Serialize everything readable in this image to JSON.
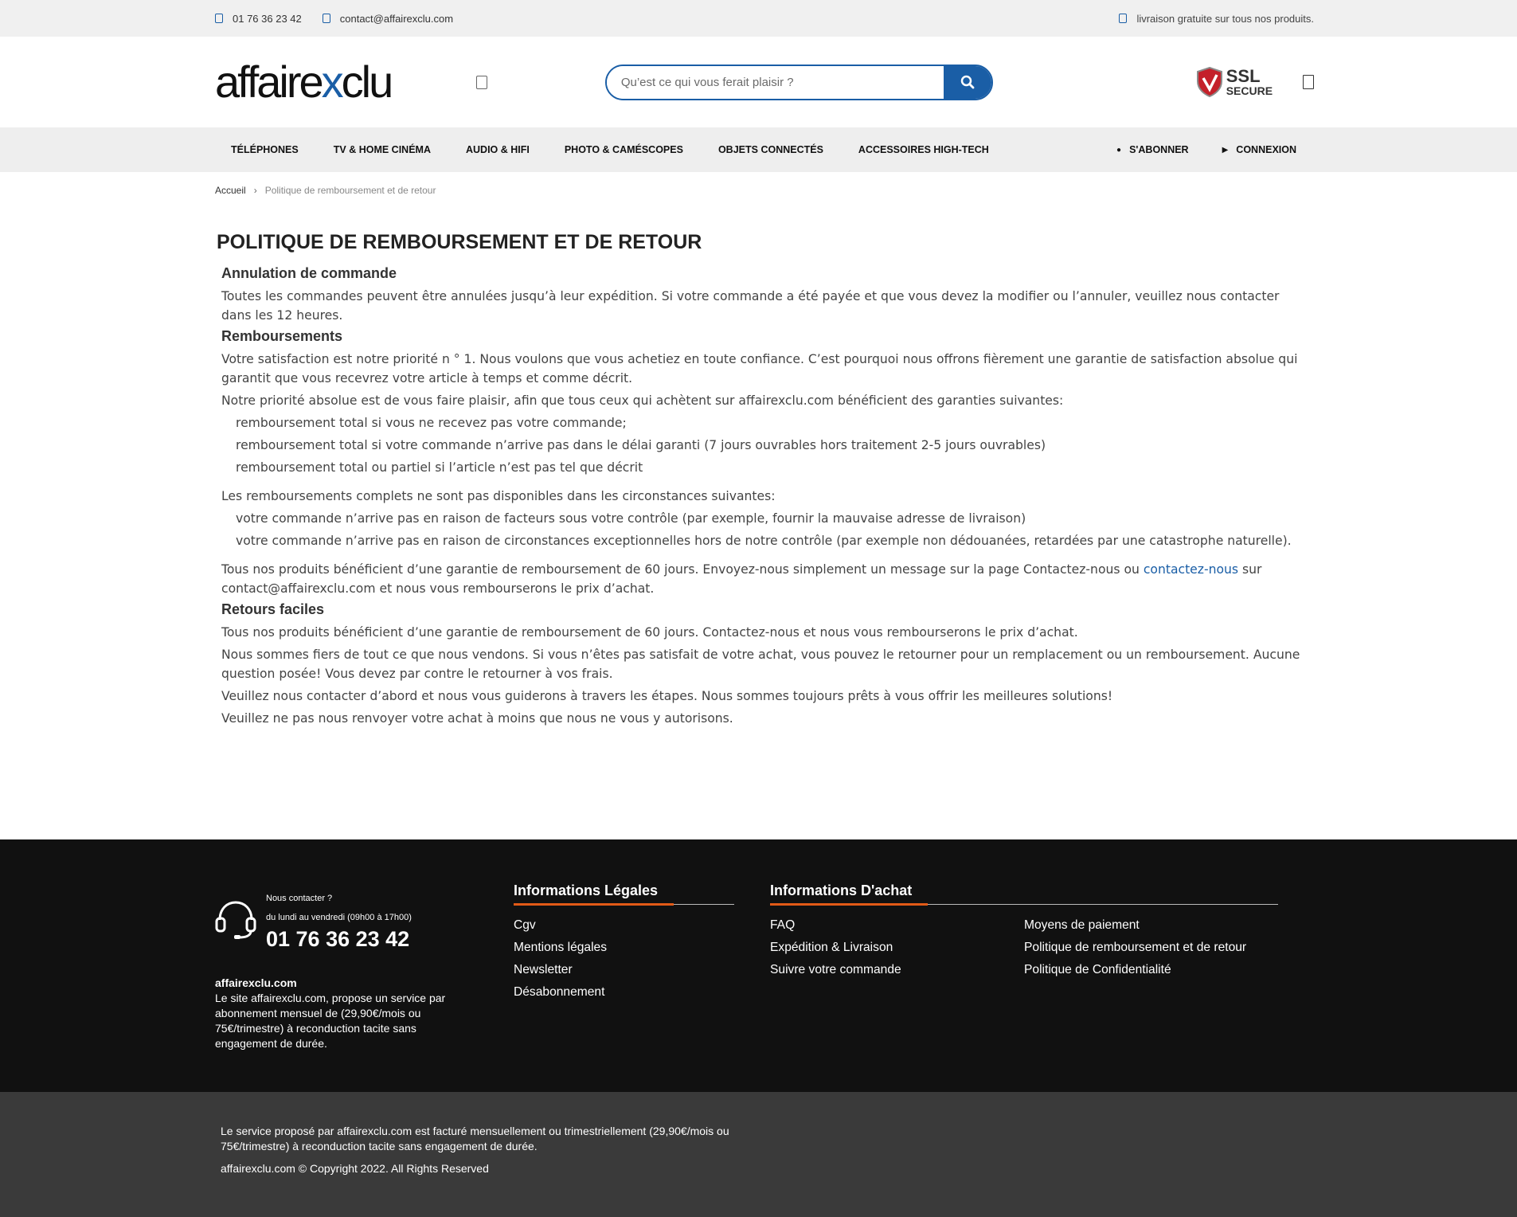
{
  "topbar": {
    "phone": "01 76 36 23 42",
    "email": "contact@affairexclu.com",
    "shipping": "livraison gratuite sur tous nos produits."
  },
  "header": {
    "logo_pre": "affaire",
    "logo_x": "x",
    "logo_post": "clu",
    "search_placeholder": "Qu’est ce qui vous ferait plaisir ?",
    "ssl_line1": "SSL",
    "ssl_line2": "SECURE"
  },
  "nav": {
    "items": [
      "Téléphones",
      "TV & Home Cinéma",
      "Audio & HiFi",
      "Photo & Caméscopes",
      "Objets connectés",
      "Accessoires High-Tech"
    ],
    "subscribe": "S'ABONNER",
    "login": "CONNEXION"
  },
  "breadcrumb": {
    "home": "Accueil",
    "sep": "›",
    "current": "Politique de remboursement et de retour"
  },
  "page": {
    "title": "POLITIQUE DE REMBOURSEMENT ET DE RETOUR",
    "s1_title": "Annulation de commande",
    "s1_p1": "Toutes les commandes peuvent être annulées jusqu’à leur expédition. Si votre commande a été payée et que vous devez la modifier ou l’annuler, veuillez nous contacter dans les 12 heures.",
    "s2_title": "Remboursements",
    "s2_p1": "Votre satisfaction est notre priorité n ° 1. Nous voulons que vous achetiez en toute confiance. C’est pourquoi nous offrons fièrement une garantie de satisfaction absolue qui garantit que vous recevrez votre article à temps et comme décrit.",
    "s2_p2": "Notre priorité absolue est de vous faire plaisir, afin que tous ceux qui achètent sur affairexclu.com bénéficient des garanties suivantes:",
    "s2_list1": [
      "remboursement total si vous ne recevez pas votre commande;",
      "remboursement total si votre commande n’arrive pas dans le délai garanti (7 jours ouvrables hors traitement 2-5 jours ouvrables)",
      "remboursement total ou partiel si l’article n’est pas tel que décrit"
    ],
    "s2_p3": "Les remboursements complets ne sont pas disponibles dans les circonstances suivantes:",
    "s2_list2": [
      "votre commande n’arrive pas en raison de facteurs sous votre contrôle (par exemple, fournir la mauvaise adresse de livraison)",
      "votre commande n’arrive pas en raison de circonstances exceptionnelles hors de notre contrôle (par exemple non dédouanées, retardées par une catastrophe naturelle)."
    ],
    "s2_p4_a": "Tous nos produits bénéficient d’une garantie de remboursement de 60 jours. Envoyez-nous simplement un message sur la page Contactez-nous ou ",
    "s2_p4_link": "contactez-nous",
    "s2_p4_b": " sur contact@affairexclu.com et nous vous rembourserons le prix d’achat.",
    "s3_title": "Retours faciles",
    "s3_p1": "Tous nos produits bénéficient d’une garantie de remboursement de 60 jours. Contactez-nous et nous vous rembourserons le prix d’achat.",
    "s3_p2": "Nous sommes fiers de tout ce que nous vendons. Si vous n’êtes pas satisfait de votre achat, vous pouvez le retourner pour un remplacement ou un remboursement. Aucune question posée! Vous devez par contre le retourner à vos frais.",
    "s3_p3": "Veuillez nous contacter d’abord et nous vous guiderons à travers les étapes. Nous sommes toujours prêts à vous offrir les meilleures solutions!",
    "s3_p4": "Veuillez ne pas nous renvoyer votre achat à moins que nous ne vous y autorisons."
  },
  "footer": {
    "contact_label": "Nous contacter ?",
    "hours": "du lundi au vendredi (09h00 à 17h00)",
    "phone": "01 76 36 23 42",
    "about_title": "affairexclu.com",
    "about_text": "Le site affairexclu.com, propose un service par abonnement mensuel de (29,90€/mois ou 75€/trimestre) à reconduction tacite sans engagement de durée.",
    "legal_title": "Informations Légales",
    "legal_links": [
      "Cgv",
      "Mentions légales",
      "Newsletter",
      "Désabonnement"
    ],
    "purchase_title": "Informations D'achat",
    "purchase_links_a": [
      "FAQ",
      "Expédition & Livraison",
      "Suivre votre commande"
    ],
    "purchase_links_b": [
      "Moyens de paiement",
      "Politique de remboursement et de retour",
      "Politique de Confidentialité"
    ],
    "bottom_text": "Le service proposé par affairexclu.com est facturé mensuellement ou trimestriellement (29,90€/mois ou 75€/trimestre) à reconduction tacite sans engagement de durée.",
    "copyright": "affairexclu.com © Copyright 2022. All Rights Reserved"
  },
  "colors": {
    "brand_blue": "#1a5ea6",
    "footer_accent": "#e25a17",
    "footer_bg": "#111111",
    "bottom_bg": "#3a3a3a"
  }
}
